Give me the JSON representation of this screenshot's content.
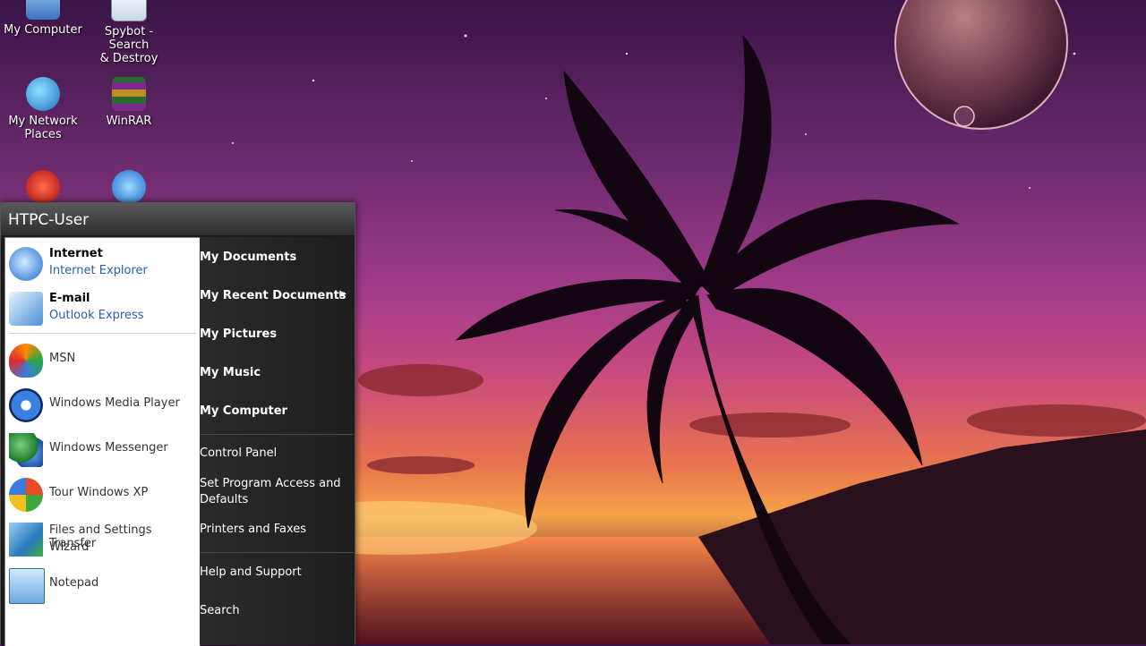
{
  "desktop": {
    "icons": [
      {
        "label_line1": "My Computer",
        "label_line2": ""
      },
      {
        "label_line1": "Spybot - Search",
        "label_line2": "& Destroy"
      },
      {
        "label_line1": "My Network",
        "label_line2": "Places"
      },
      {
        "label_line1": "WinRAR",
        "label_line2": ""
      }
    ]
  },
  "start_menu": {
    "user": "HTPC-User",
    "pinned": [
      {
        "title": "Internet",
        "subtitle": "Internet Explorer"
      },
      {
        "title": "E-mail",
        "subtitle": "Outlook Express"
      }
    ],
    "recent": [
      {
        "label": "MSN"
      },
      {
        "label": "Windows Media Player"
      },
      {
        "label": "Windows Messenger"
      },
      {
        "label": "Tour Windows XP"
      },
      {
        "label_line1": "Files and Settings Transfer",
        "label_line2": "Wizard"
      },
      {
        "label": "Notepad"
      }
    ],
    "places": [
      {
        "label": "My Documents"
      },
      {
        "label": "My Recent Documents"
      },
      {
        "label": "My Pictures"
      },
      {
        "label": "My Music"
      },
      {
        "label": "My Computer"
      }
    ],
    "system": [
      {
        "label": "Control Panel"
      },
      {
        "label_line1": "Set Program Access and",
        "label_line2": "Defaults"
      },
      {
        "label": "Printers and Faxes"
      }
    ],
    "help": [
      {
        "label": "Help and Support"
      },
      {
        "label": "Search"
      }
    ]
  },
  "colors": {
    "sky_top": "#3a1446",
    "sky_mid": "#a23b8a",
    "sunset": "#f5a44a",
    "link_blue": "#2a5db0"
  }
}
